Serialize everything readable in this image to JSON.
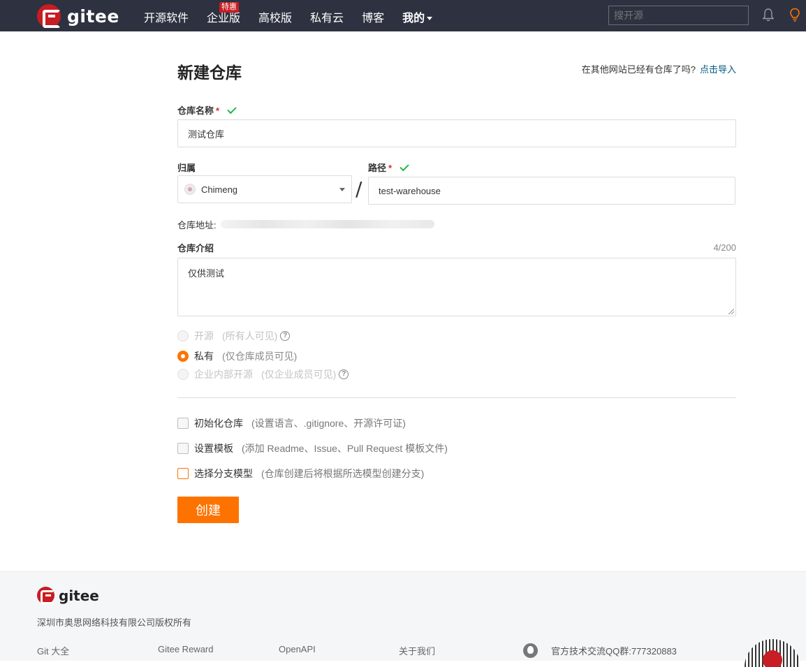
{
  "header": {
    "brand": "gitee",
    "nav": [
      "开源软件",
      "企业版",
      "高校版",
      "私有云",
      "博客",
      "我的"
    ],
    "nav_badge": "特惠",
    "search_placeholder": "搜开源",
    "icons": [
      "bell-icon",
      "lightbulb-icon"
    ],
    "colors": {
      "bar": "#2e3240",
      "brand": "#c71d23"
    }
  },
  "page": {
    "title": "新建仓库",
    "import_prompt": "在其他网站已经有仓库了吗?",
    "import_link": "点击导入",
    "repo_name_label": "仓库名称",
    "repo_name_value": "测试仓库",
    "owner_label": "归属",
    "owner_value": "Chimeng",
    "separator": "/",
    "path_label": "路径",
    "path_value": "test-warehouse",
    "required_mark": "*",
    "address_label": "仓库地址:",
    "desc_label": "仓库介绍",
    "desc_count": "4/200",
    "desc_value": "仅供测试",
    "visibility": [
      {
        "label": "开源",
        "hint": "(所有人可见)",
        "selected": false,
        "disabled": true,
        "help": true
      },
      {
        "label": "私有",
        "hint": "(仅仓库成员可见)",
        "selected": true,
        "disabled": false,
        "help": false
      },
      {
        "label": "企业内部开源",
        "hint": "(仅企业成员可见)",
        "selected": false,
        "disabled": true,
        "help": true
      }
    ],
    "options": [
      {
        "label": "初始化仓库",
        "hint": "(设置语言、.gitignore、开源许可证)"
      },
      {
        "label": "设置模板",
        "hint": "(添加 Readme、Issue、Pull Request 模板文件)"
      },
      {
        "label": "选择分支模型",
        "hint": "(仓库创建后将根据所选模型创建分支)"
      }
    ],
    "create_button": "创建",
    "accent": "#fe7300"
  },
  "footer": {
    "brand": "gitee",
    "copyright": "深圳市奥思网络科技有限公司版权所有",
    "links": [
      "Git 大全",
      "Gitee Reward",
      "OpenAPI",
      "关于我们"
    ],
    "qq_group": "官方技术交流QQ群:777320883"
  }
}
